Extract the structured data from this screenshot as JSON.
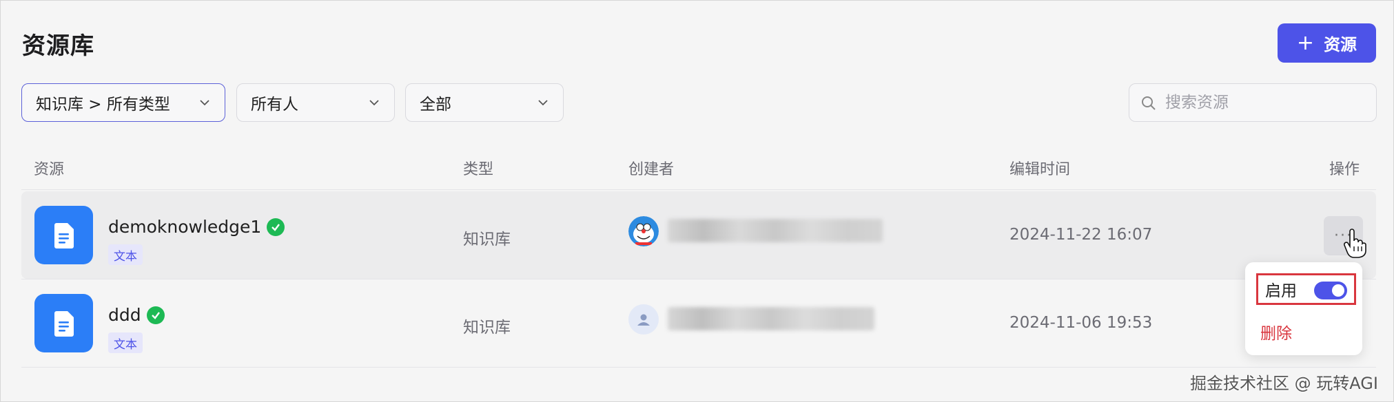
{
  "header": {
    "title": "资源库",
    "add_button": {
      "plus": "+",
      "label": "资源"
    }
  },
  "filters": {
    "category": "知识库 > 所有类型",
    "owner": "所有人",
    "status": "全部",
    "search_placeholder": "搜索资源"
  },
  "table": {
    "columns": [
      "资源",
      "类型",
      "创建者",
      "编辑时间",
      "操作"
    ],
    "rows": [
      {
        "name": "demoknowledge1",
        "tag": "文本",
        "type": "知识库",
        "edited": "2024-11-22 16:07"
      },
      {
        "name": "ddd",
        "tag": "文本",
        "type": "知识库",
        "edited": "2024-11-06 19:53"
      }
    ],
    "more_label": "···"
  },
  "action_menu": {
    "enable_label": "启用",
    "enable_on": true,
    "delete_label": "删除"
  },
  "watermark": "掘金技术社区 @ 玩转AGI",
  "colors": {
    "accent": "#4d53e8",
    "doc_icon": "#2b7ef7",
    "success": "#1db954",
    "danger": "#d9363e"
  }
}
